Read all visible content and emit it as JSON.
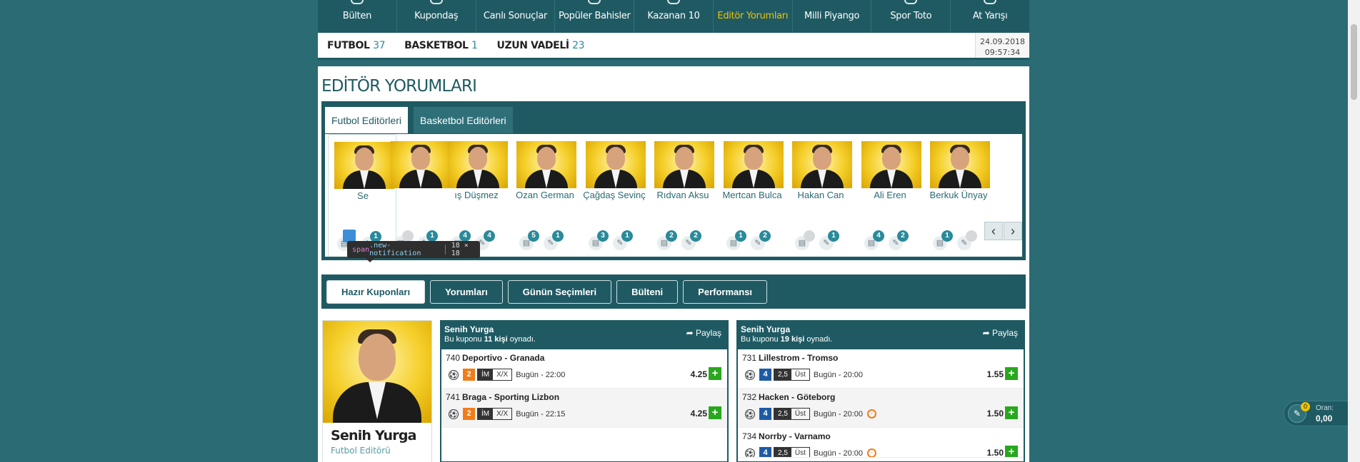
{
  "topnav": {
    "items": [
      {
        "label": "Bülten"
      },
      {
        "label": "Kupondaş"
      },
      {
        "label": "Canlı Sonuçlar"
      },
      {
        "label": "Popüler Bahisler"
      },
      {
        "label": "Kazanan 10"
      },
      {
        "label": "Editör Yorumları"
      },
      {
        "label": "Milli Piyango"
      },
      {
        "label": "Spor Toto"
      },
      {
        "label": "At Yarışı"
      }
    ],
    "active": "Editör Yorumları"
  },
  "sportbar": {
    "sports": [
      {
        "label": "FUTBOL",
        "count": "37"
      },
      {
        "label": "BASKETBOL",
        "count": "1"
      },
      {
        "label": "UZUN VADELİ",
        "count": "23"
      }
    ],
    "date": "24.09.2018",
    "time": "09:57:34"
  },
  "page_title": "EDİTÖR YORUMLARI",
  "editor_tabs": [
    {
      "label": "Futbol Editörleri"
    },
    {
      "label": "Basketbol Editörleri"
    }
  ],
  "editors": [
    {
      "name": "Senih Yurga",
      "shown": "Se",
      "docs": "",
      "pens": "1"
    },
    {
      "name": "Barış Düşmez",
      "shown": "",
      "docs": "",
      "pens": "1"
    },
    {
      "name": "Barış Düşmez",
      "shown": "ış Düşmez",
      "docs": "4",
      "pens": "4"
    },
    {
      "name": "Ozan German",
      "shown": "Ozan German",
      "docs": "5",
      "pens": "1"
    },
    {
      "name": "Çağdaş Sevinç",
      "shown": "Çağdaş Sevinç",
      "docs": "3",
      "pens": "1"
    },
    {
      "name": "Rıdvan Aksu",
      "shown": "Rıdvan Aksu",
      "docs": "2",
      "pens": "2"
    },
    {
      "name": "Mertcan Bulca",
      "shown": "Mertcan Bulca",
      "docs": "1",
      "pens": "2"
    },
    {
      "name": "Hakan Can",
      "shown": "Hakan Can",
      "docs": "",
      "pens": "1"
    },
    {
      "name": "Ali Eren",
      "shown": "Ali Eren",
      "docs": "4",
      "pens": "2"
    },
    {
      "name": "Berkuk Ünyay",
      "shown": "Berkuk Ünyay",
      "docs": "1",
      "pens": ""
    }
  ],
  "tooltip": {
    "tag": "span",
    "cls": ".new-notification",
    "size": "18 × 18"
  },
  "section_buttons": [
    {
      "label": "Hazır Kuponları"
    },
    {
      "label": "Yorumları"
    },
    {
      "label": "Günün Seçimleri"
    },
    {
      "label": "Bülteni"
    },
    {
      "label": "Performansı"
    }
  ],
  "profile": {
    "name": "Senih Yurga",
    "role": "Futbol Editörü"
  },
  "coupons": [
    {
      "editor": "Senih Yurga",
      "played_pre": "Bu kuponu ",
      "played_count": "11 kişi",
      "played_post": " oynadı.",
      "share": "Paylaş",
      "matches": [
        {
          "code": "740",
          "teams": "Deportivo - Granada",
          "mbs": "2",
          "market": "İM",
          "pick": "X/X",
          "time": "Bugün - 22:00",
          "odd": "4.25"
        },
        {
          "code": "741",
          "teams": "Braga - Sporting Lizbon",
          "mbs": "2",
          "market": "İM",
          "pick": "X/X",
          "time": "Bugün - 22:15",
          "odd": "4.25"
        }
      ]
    },
    {
      "editor": "Senih Yurga",
      "played_pre": "Bu kuponu ",
      "played_count": "19 kişi",
      "played_post": " oynadı.",
      "share": "Paylaş",
      "matches": [
        {
          "code": "731",
          "teams": "Lillestrom - Tromso",
          "mbs": "4",
          "market": "2,5",
          "pick": "Üst",
          "time": "Bugün - 20:00",
          "odd": "1.55"
        },
        {
          "code": "732",
          "teams": "Hacken - Göteborg",
          "mbs": "4",
          "market": "2,5",
          "pick": "Üst",
          "time": "Bugün - 20:00",
          "odd": "1.50"
        },
        {
          "code": "734",
          "teams": "Norrby - Varnamo",
          "mbs": "4",
          "market": "2,5",
          "pick": "Üst",
          "time": "Bugün - 20:00",
          "odd": "1.50"
        }
      ]
    }
  ],
  "slip": {
    "count": "0",
    "label": "Oran:",
    "value": "0,00"
  },
  "colors": {
    "brand": "#1f5a63",
    "background": "#2a6b74",
    "accent": "#f2c200",
    "add": "#28a81e",
    "mbs_orange": "#f07d1a",
    "mbs_blue": "#1d5aa3"
  },
  "icons": {
    "share": "share-arrow-icon",
    "ball": "soccer-ball-icon",
    "doc": "document-icon",
    "pen": "pencil-icon",
    "clock": "live-clock-icon"
  }
}
